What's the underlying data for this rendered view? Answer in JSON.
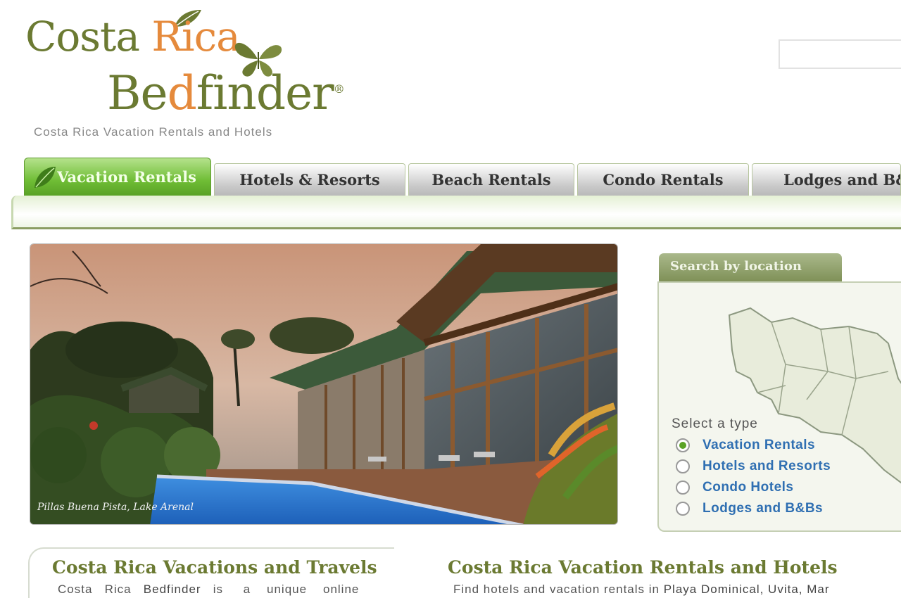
{
  "logo": {
    "line1_start": "Costa ",
    "line1_accent": "Rica",
    "line2_start": "Be",
    "line2_accent": "d",
    "line2_end": "finder",
    "registered": "®",
    "tagline": "Costa Rica Vacation Rentals and Hotels"
  },
  "nav": {
    "tabs": [
      {
        "label": "Vacation Rentals",
        "active": true
      },
      {
        "label": "Hotels & Resorts",
        "active": false
      },
      {
        "label": "Beach Rentals",
        "active": false
      },
      {
        "label": "Condo Rentals",
        "active": false
      },
      {
        "label": "Lodges and B&Bs",
        "active": false
      }
    ]
  },
  "hero": {
    "caption": "Pillas Buena Pista, Lake Arenal"
  },
  "sidebar": {
    "tab_title": "Search by location",
    "select_title": "Select a type",
    "options": [
      {
        "label": "Vacation Rentals",
        "selected": true
      },
      {
        "label": "Hotels and Resorts",
        "selected": false
      },
      {
        "label": "Condo Hotels",
        "selected": false
      },
      {
        "label": "Lodges and B&Bs",
        "selected": false
      }
    ]
  },
  "content": {
    "left_heading": "Costa Rica Vacations and Travels",
    "left_text_1": "Costa",
    "left_text_2": "Rica",
    "left_text_3": "Bedfinder",
    "left_text_4": "is",
    "left_text_5": "a",
    "left_text_6": "unique",
    "left_text_7": "online",
    "right_heading": "Costa Rica Vacation Rentals and Hotels",
    "right_text_start": "Find hotels and vacation rentals in ",
    "right_text_places": "Playa Dominical, Uvita, Mar"
  },
  "colors": {
    "brand_green": "#6b7a32",
    "accent_orange": "#e58a3c",
    "active_tab": "#6fbd35",
    "link_blue": "#2f6fb2"
  }
}
